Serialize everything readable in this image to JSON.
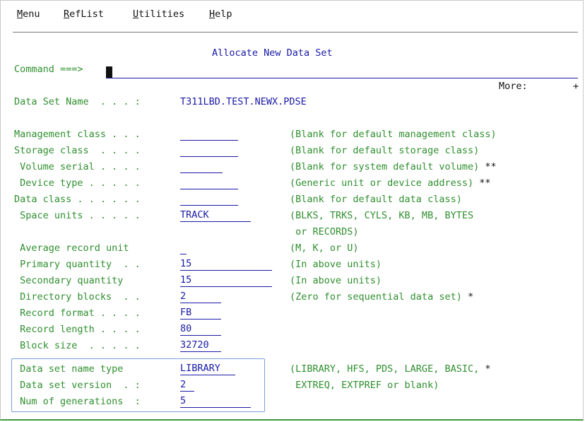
{
  "menu": {
    "items": [
      {
        "key": "M",
        "rest": "enu"
      },
      {
        "key": "R",
        "rest": "efList"
      },
      {
        "key": "U",
        "rest": "tilities"
      },
      {
        "key": "H",
        "rest": "elp"
      }
    ]
  },
  "panel": {
    "title": "Allocate New Data Set",
    "command_label": "Command ===>",
    "command_value": "",
    "more_label": "More:",
    "more_indicator": "+"
  },
  "dsname": {
    "label": "Data Set Name  . . . :",
    "value": "T311LBD.TEST.NEWX.PDSE"
  },
  "fields": [
    {
      "label": "Management class . . .",
      "value": "",
      "desc": "(Blank for default management class)",
      "mark": ""
    },
    {
      "label": "Storage class  . . . .",
      "value": "",
      "desc": "(Blank for default storage class)",
      "mark": ""
    },
    {
      "label": " Volume serial . . . .",
      "value": "",
      "desc": "(Blank for system default volume)",
      "mark": "**"
    },
    {
      "label": " Device type . . . . .",
      "value": "",
      "desc": "(Generic unit or device address)",
      "mark": "**"
    },
    {
      "label": "Data class . . . . . .",
      "value": "",
      "desc": "(Blank for default data class)",
      "mark": ""
    },
    {
      "label": " Space units . . . . .",
      "value": "TRACK",
      "desc": "(BLKS, TRKS, CYLS, KB, MB, BYTES",
      "mark": ""
    },
    {
      "label": "",
      "value": "",
      "desc": " or RECORDS)",
      "mark": ""
    },
    {
      "label": " Average record unit",
      "value": "",
      "desc": "(M, K, or U)",
      "mark": ""
    },
    {
      "label": " Primary quantity  . .",
      "value": "15",
      "desc": "(In above units)",
      "mark": ""
    },
    {
      "label": " Secondary quantity",
      "value": "15",
      "desc": "(In above units)",
      "mark": ""
    },
    {
      "label": " Directory blocks  . .",
      "value": "2",
      "desc": "(Zero for sequential data set)",
      "mark": "*"
    },
    {
      "label": " Record format . . . .",
      "value": "FB",
      "desc": "",
      "mark": ""
    },
    {
      "label": " Record length . . . .",
      "value": "80",
      "desc": "",
      "mark": ""
    },
    {
      "label": " Block size  . . . . .",
      "value": "32720",
      "desc": "",
      "mark": ""
    },
    {
      "label": " Data set name type",
      "value": "LIBRARY",
      "desc": "(LIBRARY, HFS, PDS, LARGE, BASIC,",
      "mark": "*"
    },
    {
      "label": " Data set version  . :",
      "value": "2",
      "desc": " EXTREQ, EXTPREF or blank)",
      "mark": ""
    },
    {
      "label": " Num of generations  :",
      "value": "5",
      "desc": "",
      "mark": ""
    }
  ],
  "colors": {
    "label_green": "#2f8f2f",
    "input_blue": "#1a1aa6",
    "highlight_box": "#7aa0d6"
  }
}
